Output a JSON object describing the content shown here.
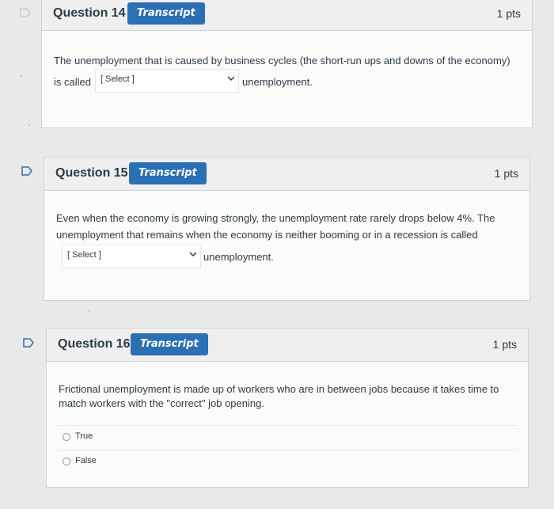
{
  "transcript_label": "Transcript",
  "questions": [
    {
      "title": "Question 14",
      "points": "1 pts",
      "text_line1": "The unemployment that is caused by business cycles (the short-run ups and downs of the economy)",
      "text_prefix": "is called",
      "select_placeholder": "[ Select ]",
      "text_suffix": "unemployment."
    },
    {
      "title": "Question 15",
      "points": "1 pts",
      "text_line1": "Even when the economy is growing strongly, the unemployment rate rarely drops below 4%. The",
      "text_line2": "unemployment that remains when the economy is neither booming or in a recession is called",
      "select_placeholder": "[ Select ]",
      "text_suffix": "unemployment."
    },
    {
      "title": "Question 16",
      "points": "1 pts",
      "text_line1": "Frictional unemployment is made up of workers who are in between jobs because it takes time to",
      "text_line2": "match workers with the \"correct\" job opening.",
      "options": [
        "True",
        "False"
      ]
    }
  ],
  "icons": {
    "flag": "flag-outline-icon",
    "chevron": "chevron-down-icon",
    "radio": "radio-unchecked-icon"
  },
  "colors": {
    "transcript_button": "#2b6fb5",
    "header_background": "#efefef",
    "card_background": "#fbfbfa"
  }
}
